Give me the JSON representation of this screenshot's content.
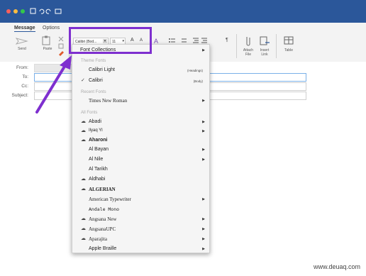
{
  "ribbon": {
    "tabs": [
      "Message",
      "Options"
    ],
    "send_label": "Send",
    "paste_label": "Paste",
    "font_name": "Calibri (Bod...",
    "font_size": "11",
    "grow_label": "A",
    "shrink_label": "A",
    "attach_label": "Attach File",
    "link_label": "Insert Link",
    "table_label": "Table"
  },
  "headers": {
    "from_label": "From:",
    "to_label": "To:",
    "cc_label": "Cc:",
    "subject_label": "Subject:"
  },
  "menu": {
    "font_collections": "Font Collections",
    "theme_fonts_header": "Theme Fonts",
    "theme_fonts": [
      {
        "name": "Calibri Light",
        "hint": "(Headings)"
      },
      {
        "name": "Calibri",
        "hint": "(Body)"
      }
    ],
    "recent_fonts_header": "Recent Fonts",
    "recent_fonts": [
      "Times New Roman"
    ],
    "all_fonts_header": "All Fonts",
    "all_fonts": [
      "Abadi",
      "Ilyaq Yl",
      "Aharoni",
      "Al Bayan",
      "Al Nile",
      "Al Tarikh",
      "Aldhabi",
      "ALGERIAN",
      "American Typewriter",
      "Andale Mono",
      "Angsana New",
      "AngsanaUPC",
      "Aparajita",
      "Apple Braille"
    ]
  },
  "credit": "www.deuaq.com",
  "colors": {
    "titlebar": "#2b579a",
    "highlight": "#7e2fcf"
  }
}
